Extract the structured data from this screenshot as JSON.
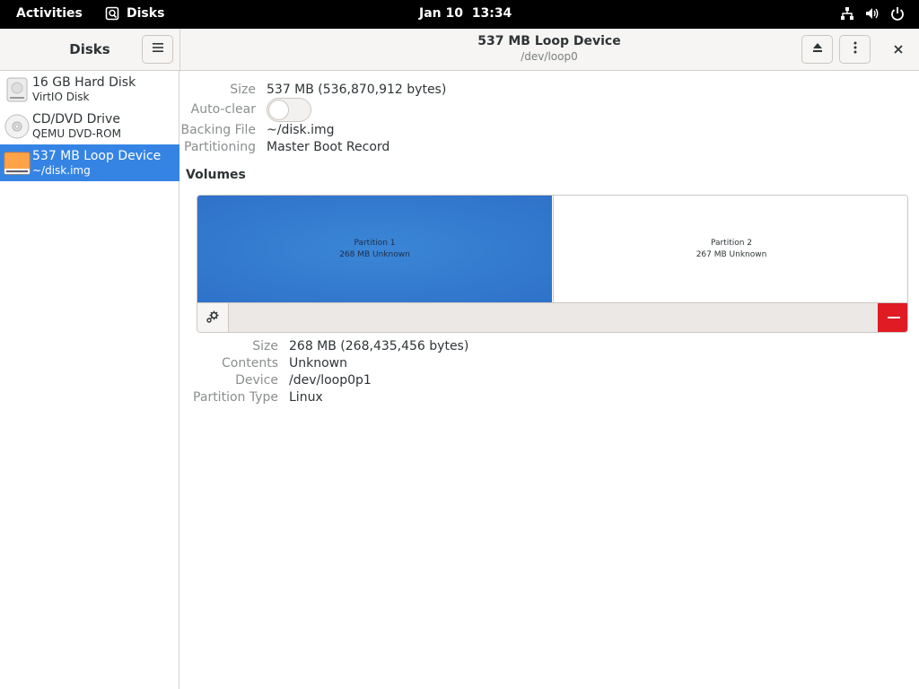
{
  "topbar": {
    "activities": "Activities",
    "app_name": "Disks",
    "date": "Jan 10",
    "time": "13:34",
    "icons": [
      "network-icon",
      "volume-icon",
      "power-icon"
    ]
  },
  "header": {
    "sidebar_title": "Disks",
    "title": "537 MB Loop Device",
    "subtitle": "/dev/loop0"
  },
  "sidebar": {
    "items": [
      {
        "name": "16 GB Hard Disk",
        "sub": "VirtIO Disk",
        "icon": "hard-disk-icon"
      },
      {
        "name": "CD/DVD Drive",
        "sub": "QEMU DVD-ROM",
        "icon": "optical-disc-icon"
      },
      {
        "name": "537 MB Loop Device",
        "sub": "~/disk.img",
        "icon": "loop-device-icon",
        "selected": true
      }
    ]
  },
  "device": {
    "size_label": "Size",
    "size_value": "537 MB (536,870,912 bytes)",
    "autoclear_label": "Auto-clear",
    "autoclear_on": false,
    "backing_label": "Backing File",
    "backing_value": "~/disk.img",
    "partitioning_label": "Partitioning",
    "partitioning_value": "Master Boot Record"
  },
  "volumes": {
    "title": "Volumes",
    "partitions": [
      {
        "name": "Partition 1",
        "detail": "268 MB Unknown",
        "selected": true
      },
      {
        "name": "Partition 2",
        "detail": "267 MB Unknown",
        "selected": false
      }
    ]
  },
  "partition_details": {
    "size_label": "Size",
    "size_value": "268 MB (268,435,456 bytes)",
    "contents_label": "Contents",
    "contents_value": "Unknown",
    "device_label": "Device",
    "device_value": "/dev/loop0p1",
    "type_label": "Partition Type",
    "type_value": "Linux"
  },
  "colors": {
    "accent": "#3584e4",
    "partition_selected": "#2e72c9",
    "delete": "#e01b24"
  }
}
